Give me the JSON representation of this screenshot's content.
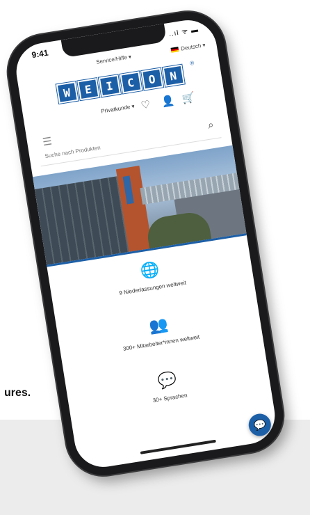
{
  "caption_cutoff": "ures.",
  "status": {
    "time": "9:41",
    "signal": "..ıl ᯤ ▬"
  },
  "topbar": {
    "service": "Service/Hilfe ▾",
    "language": "Deutsch ▾"
  },
  "logo": {
    "letters": [
      "W",
      "E",
      "I",
      "C",
      "O",
      "N"
    ],
    "registered": "®"
  },
  "header": {
    "customer_type": "Privatkunde ▾",
    "icons": [
      "heart-icon",
      "user-icon",
      "cart-icon"
    ]
  },
  "search": {
    "placeholder": "Suche nach Produkten"
  },
  "stats": [
    {
      "icon": "globe-icon",
      "label": "9 Niederlassungen weltweit"
    },
    {
      "icon": "people-icon",
      "label": "300+ Mitarbeiter*innen weltweit"
    },
    {
      "icon": "speech-bubble-icon",
      "label": "30+ Sprachen"
    }
  ],
  "colors": {
    "brand": "#1d5fa7"
  }
}
